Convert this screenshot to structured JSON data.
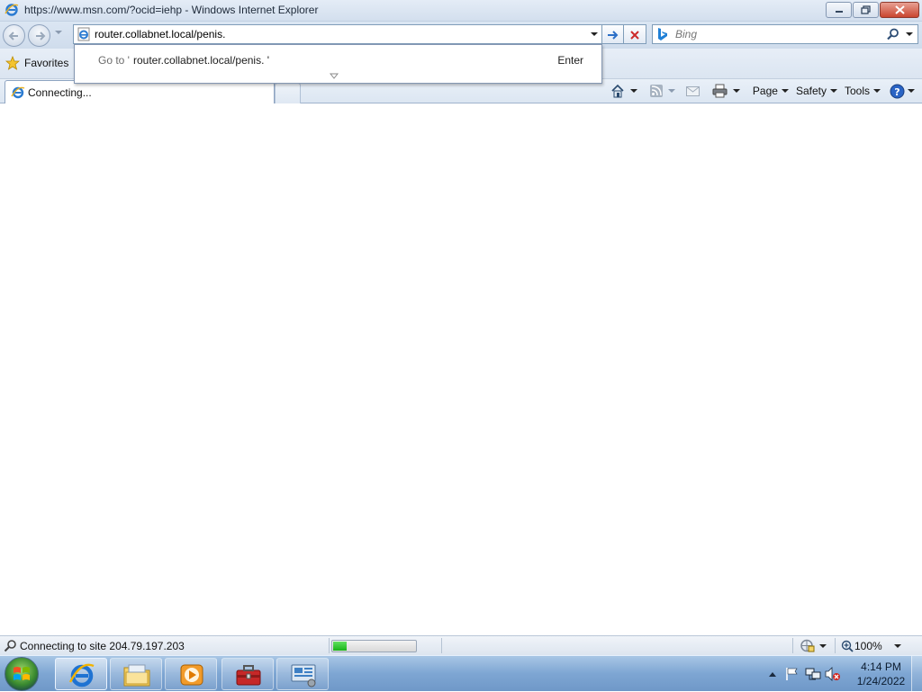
{
  "window": {
    "title": "https://www.msn.com/?ocid=iehp - Windows Internet Explorer"
  },
  "address_bar": {
    "value": "router.collabnet.local/penis."
  },
  "search_box": {
    "placeholder": "Bing"
  },
  "favorites_bar": {
    "favorites_label": "Favorites"
  },
  "tabs": [
    {
      "label": "Connecting...",
      "active": true
    }
  ],
  "command_bar": {
    "page_label": "Page",
    "safety_label": "Safety",
    "tools_label": "Tools"
  },
  "autocomplete": {
    "goto_prefix": "Go to '",
    "goto_url": "router.collabnet.local/penis. '",
    "enter_label": "Enter"
  },
  "status_bar": {
    "status_text": "Connecting to site 204.79.197.203",
    "progress": 0.17,
    "zoom": "100%"
  },
  "taskbar": {
    "time": "4:14 PM",
    "date": "1/24/2022"
  },
  "colors": {
    "accent_blue": "#3a6ea5",
    "progress_green": "#18b418",
    "stop_red": "#cc2a2a"
  }
}
